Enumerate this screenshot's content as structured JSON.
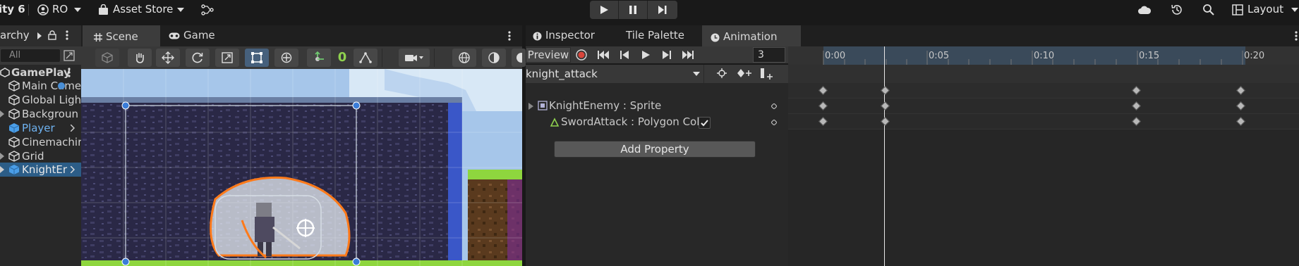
{
  "topbar": {
    "app_title": "ity 6",
    "account": "RO",
    "asset_store": "Asset Store",
    "layout": "Layout"
  },
  "hierarchy": {
    "tab_label": "archy",
    "search_placeholder": "All",
    "items": [
      {
        "label": "GamePlay"
      },
      {
        "label": "Main Came"
      },
      {
        "label": "Global Ligh"
      },
      {
        "label": "Backgroun"
      },
      {
        "label": "Player"
      },
      {
        "label": "Cinemachir"
      },
      {
        "label": "Grid"
      },
      {
        "label": "KnightEr"
      }
    ]
  },
  "scene": {
    "tab_scene": "Scene",
    "tab_game": "Game",
    "snap_count": "0"
  },
  "animation": {
    "tab_inspector": "Inspector",
    "tab_tile_palette": "Tile Palette",
    "tab_animation": "Animation",
    "preview_label": "Preview",
    "frame_value": "3",
    "clip_name": "knight_attack",
    "properties": [
      {
        "label": "KnightEnemy : Sprite"
      },
      {
        "label": "SwordAttack : Polygon Coll"
      }
    ],
    "add_property_label": "Add Property",
    "ruler_labels": [
      "0:00",
      "0:05",
      "0:10",
      "0:15",
      "0:20"
    ],
    "colors": {
      "accent": "#2c5d87",
      "record_red": "#d9453b"
    }
  }
}
